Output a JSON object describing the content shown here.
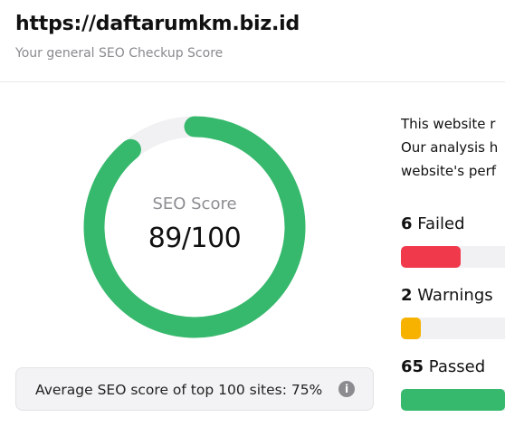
{
  "header": {
    "url": "https://daftarumkm.biz.id",
    "subtitle": "Your general SEO Checkup Score"
  },
  "score": {
    "label": "SEO Score",
    "value_text": "89/100",
    "value": 89,
    "max": 100,
    "color": "#36b96c",
    "track_color": "#f1f1f3"
  },
  "average": {
    "text": "Average SEO score of top 100 sites: 75%",
    "icon": "info-icon",
    "icon_glyph": "i"
  },
  "description": {
    "lines": [
      "This website r",
      "Our analysis h",
      "website's perf"
    ]
  },
  "stats": [
    {
      "count": "6",
      "label": "Failed",
      "color": "#f0394b",
      "fill_fraction": 0.57
    },
    {
      "count": "2",
      "label": "Warnings",
      "color": "#f7b200",
      "fill_fraction": 0.19
    },
    {
      "count": "65",
      "label": "Passed",
      "color": "#36b96c",
      "fill_fraction": 1.0
    }
  ]
}
